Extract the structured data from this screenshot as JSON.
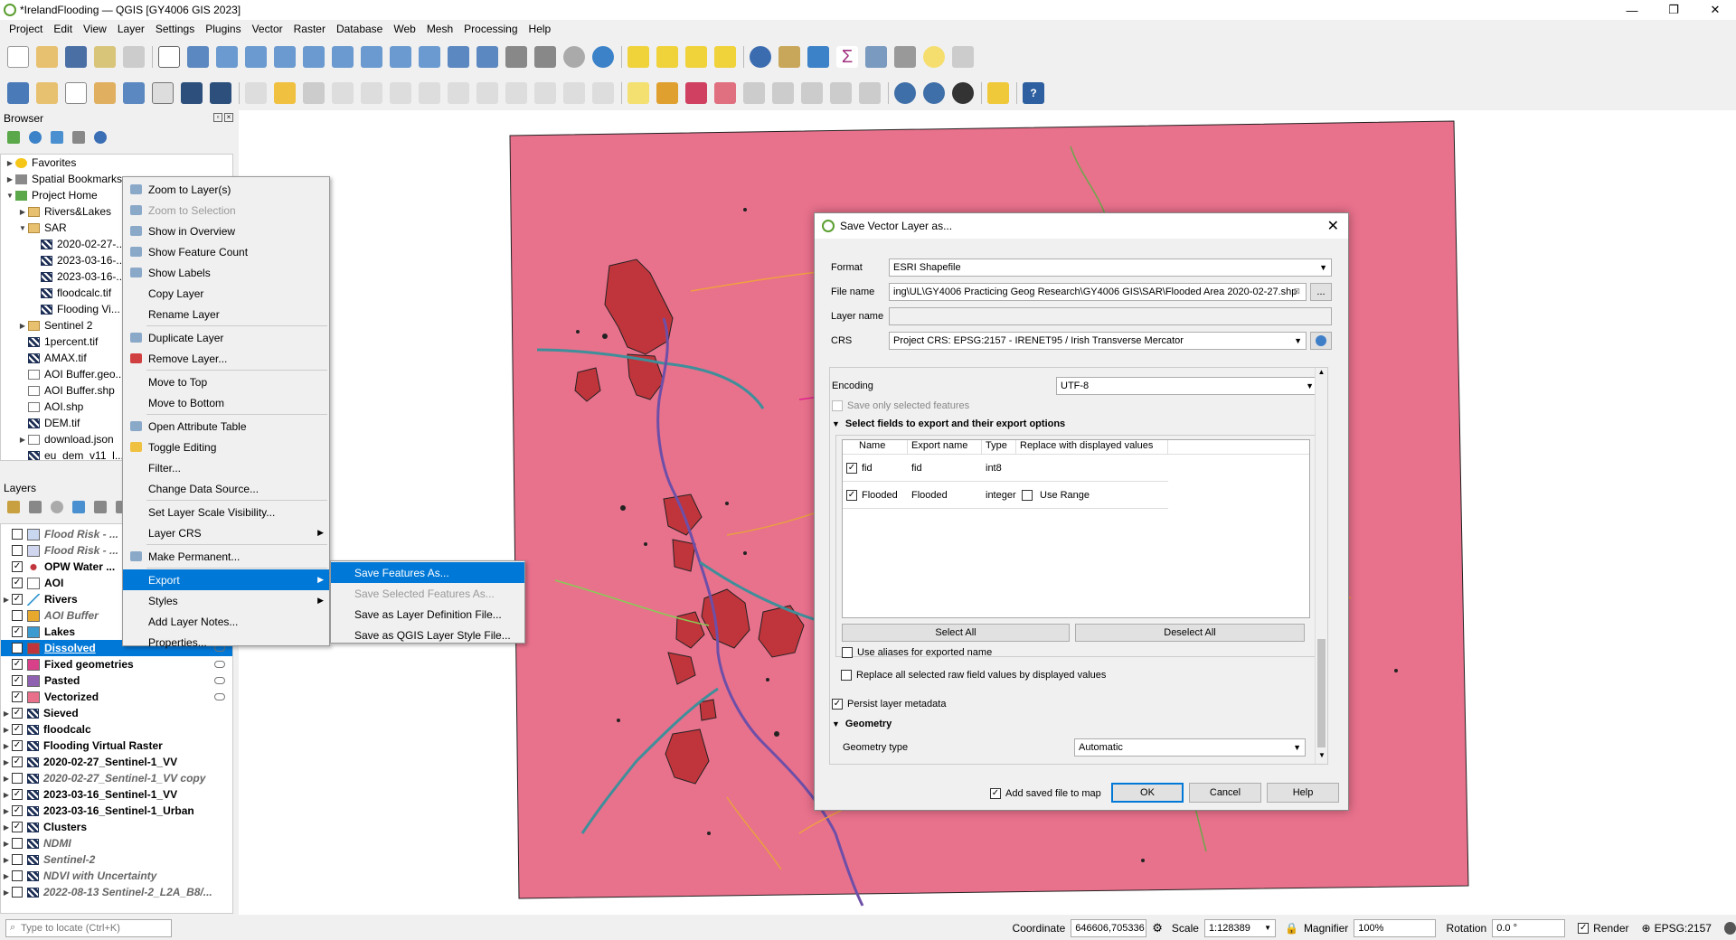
{
  "window": {
    "title": "*IrelandFlooding — QGIS [GY4006 GIS 2023]",
    "controls": [
      "—",
      "❐",
      "✕"
    ]
  },
  "menu": [
    "Project",
    "Edit",
    "View",
    "Layer",
    "Settings",
    "Plugins",
    "Vector",
    "Raster",
    "Database",
    "Web",
    "Mesh",
    "Processing",
    "Help"
  ],
  "browser": {
    "title": "Browser",
    "items": [
      {
        "label": "Favorites",
        "indent": 0,
        "arrow": "▶",
        "icon": "star"
      },
      {
        "label": "Spatial Bookmarks",
        "indent": 0,
        "arrow": "▶",
        "icon": "bookmark"
      },
      {
        "label": "Project Home",
        "indent": 0,
        "arrow": "▼",
        "icon": "home"
      },
      {
        "label": "Rivers&Lakes",
        "indent": 1,
        "arrow": "▶",
        "icon": "folder"
      },
      {
        "label": "SAR",
        "indent": 1,
        "arrow": "▼",
        "icon": "folder"
      },
      {
        "label": "2020-02-27-...",
        "indent": 2,
        "arrow": "",
        "icon": "raster"
      },
      {
        "label": "2023-03-16-...",
        "indent": 2,
        "arrow": "",
        "icon": "raster"
      },
      {
        "label": "2023-03-16-...",
        "indent": 2,
        "arrow": "",
        "icon": "raster"
      },
      {
        "label": "floodcalc.tif",
        "indent": 2,
        "arrow": "",
        "icon": "raster"
      },
      {
        "label": "Flooding Vi...",
        "indent": 2,
        "arrow": "",
        "icon": "raster"
      },
      {
        "label": "Sentinel 2",
        "indent": 1,
        "arrow": "▶",
        "icon": "folder"
      },
      {
        "label": "1percent.tif",
        "indent": 1,
        "arrow": "",
        "icon": "raster"
      },
      {
        "label": "AMAX.tif",
        "indent": 1,
        "arrow": "",
        "icon": "raster"
      },
      {
        "label": "AOI Buffer.geo...",
        "indent": 1,
        "arrow": "",
        "icon": "vector"
      },
      {
        "label": "AOI Buffer.shp",
        "indent": 1,
        "arrow": "",
        "icon": "vector"
      },
      {
        "label": "AOI.shp",
        "indent": 1,
        "arrow": "",
        "icon": "vector"
      },
      {
        "label": "DEM.tif",
        "indent": 1,
        "arrow": "",
        "icon": "raster"
      },
      {
        "label": "download.json",
        "indent": 1,
        "arrow": "▶",
        "icon": "vector"
      },
      {
        "label": "eu_dem_v11_l...",
        "indent": 1,
        "arrow": "",
        "icon": "raster"
      }
    ]
  },
  "layers": {
    "title": "Layers",
    "items": [
      {
        "label": "Flood Risk - ...",
        "checked": false,
        "italic": true,
        "swatch": "#c9d6f0",
        "arrow": ""
      },
      {
        "label": "Flood Risk - ...",
        "checked": false,
        "italic": true,
        "swatch": "#d0d6ee",
        "arrow": ""
      },
      {
        "label": "OPW Water ...",
        "checked": true,
        "italic": false,
        "swatch": "dot",
        "arrow": ""
      },
      {
        "label": "AOI",
        "checked": true,
        "italic": false,
        "swatch": "#ffffff",
        "arrow": ""
      },
      {
        "label": "Rivers",
        "checked": true,
        "italic": false,
        "swatch": "line",
        "arrow": "▶"
      },
      {
        "label": "AOI Buffer",
        "checked": false,
        "italic": true,
        "swatch": "#e6a92e",
        "arrow": ""
      },
      {
        "label": "Lakes",
        "checked": true,
        "italic": false,
        "swatch": "#3b9bd1",
        "arrow": ""
      },
      {
        "label": "Dissolved",
        "checked": true,
        "italic": false,
        "swatch": "#c0353b",
        "arrow": "",
        "selected": true
      },
      {
        "label": "Fixed geometries",
        "checked": true,
        "italic": false,
        "swatch": "#d8408a",
        "arrow": ""
      },
      {
        "label": "Pasted",
        "checked": true,
        "italic": false,
        "swatch": "#8e62b0",
        "arrow": ""
      },
      {
        "label": "Vectorized",
        "checked": true,
        "italic": false,
        "swatch": "#e8708a",
        "arrow": ""
      },
      {
        "label": "Sieved",
        "checked": true,
        "italic": false,
        "swatch": "raster",
        "arrow": "▶"
      },
      {
        "label": "floodcalc",
        "checked": true,
        "italic": false,
        "swatch": "raster",
        "arrow": "▶"
      },
      {
        "label": "Flooding Virtual Raster",
        "checked": true,
        "italic": false,
        "swatch": "raster",
        "arrow": "▶"
      },
      {
        "label": "2020-02-27_Sentinel-1_VV",
        "checked": true,
        "italic": false,
        "swatch": "raster",
        "arrow": "▶"
      },
      {
        "label": "2020-02-27_Sentinel-1_VV copy",
        "checked": false,
        "italic": true,
        "swatch": "raster",
        "arrow": "▶"
      },
      {
        "label": "2023-03-16_Sentinel-1_VV",
        "checked": true,
        "italic": false,
        "swatch": "raster",
        "arrow": "▶"
      },
      {
        "label": "2023-03-16_Sentinel-1_Urban",
        "checked": true,
        "italic": false,
        "swatch": "raster",
        "arrow": "▶"
      },
      {
        "label": "Clusters",
        "checked": true,
        "italic": false,
        "swatch": "raster",
        "arrow": "▶"
      },
      {
        "label": "NDMI",
        "checked": false,
        "italic": true,
        "swatch": "raster",
        "arrow": "▶"
      },
      {
        "label": "Sentinel-2",
        "checked": false,
        "italic": true,
        "swatch": "raster",
        "arrow": "▶"
      },
      {
        "label": "NDVI with Uncertainty",
        "checked": false,
        "italic": true,
        "swatch": "raster",
        "arrow": "▶"
      },
      {
        "label": "2022-08-13 Sentinel-2_L2A_B8/...",
        "checked": false,
        "italic": true,
        "swatch": "raster",
        "arrow": "▶"
      }
    ]
  },
  "context_menu": {
    "items": [
      {
        "label": "Zoom to Layer(s)",
        "disabled": false,
        "sub": false,
        "sep": false
      },
      {
        "label": "Zoom to Selection",
        "disabled": true,
        "sub": false,
        "sep": false
      },
      {
        "label": "Show in Overview",
        "disabled": false,
        "sub": false,
        "sep": false
      },
      {
        "label": "Show Feature Count",
        "disabled": false,
        "sub": false,
        "sep": false
      },
      {
        "label": "Show Labels",
        "disabled": false,
        "sub": false,
        "sep": false
      },
      {
        "label": "Copy Layer",
        "disabled": false,
        "sub": false,
        "sep": false
      },
      {
        "label": "Rename Layer",
        "disabled": false,
        "sub": false,
        "sep": true
      },
      {
        "label": "Duplicate Layer",
        "disabled": false,
        "sub": false,
        "sep": false
      },
      {
        "label": "Remove Layer...",
        "disabled": false,
        "sub": false,
        "sep": true
      },
      {
        "label": "Move to Top",
        "disabled": false,
        "sub": false,
        "sep": false
      },
      {
        "label": "Move to Bottom",
        "disabled": false,
        "sub": false,
        "sep": true
      },
      {
        "label": "Open Attribute Table",
        "disabled": false,
        "sub": false,
        "sep": false
      },
      {
        "label": "Toggle Editing",
        "disabled": false,
        "sub": false,
        "sep": false
      },
      {
        "label": "Filter...",
        "disabled": false,
        "sub": false,
        "sep": false
      },
      {
        "label": "Change Data Source...",
        "disabled": false,
        "sub": false,
        "sep": true
      },
      {
        "label": "Set Layer Scale Visibility...",
        "disabled": false,
        "sub": false,
        "sep": false
      },
      {
        "label": "Layer CRS",
        "disabled": false,
        "sub": true,
        "sep": true
      },
      {
        "label": "Make Permanent...",
        "disabled": false,
        "sub": false,
        "sep": true
      },
      {
        "label": "Export",
        "disabled": false,
        "sub": true,
        "sep": false,
        "highlight": true
      },
      {
        "label": "Styles",
        "disabled": false,
        "sub": true,
        "sep": false
      },
      {
        "label": "Add Layer Notes...",
        "disabled": false,
        "sub": false,
        "sep": false
      },
      {
        "label": "Properties...",
        "disabled": false,
        "sub": false,
        "sep": false
      }
    ],
    "export_submenu": [
      {
        "label": "Save Features As...",
        "disabled": false,
        "highlight": true
      },
      {
        "label": "Save Selected Features As...",
        "disabled": true,
        "highlight": false
      },
      {
        "label": "Save as Layer Definition File...",
        "disabled": false,
        "highlight": false
      },
      {
        "label": "Save as QGIS Layer Style File...",
        "disabled": false,
        "highlight": false
      }
    ]
  },
  "dialog": {
    "title": "Save Vector Layer as...",
    "format_label": "Format",
    "format_value": "ESRI Shapefile",
    "filename_label": "File name",
    "filename_value": "ing\\UL\\GY4006 Practicing Geog Research\\GY4006 GIS\\SAR\\Flooded Area 2020-02-27.shp",
    "filename_browse": "...",
    "layername_label": "Layer name",
    "layername_value": "",
    "crs_label": "CRS",
    "crs_value": "Project CRS: EPSG:2157 - IRENET95 / Irish Transverse Mercator",
    "encoding_label": "Encoding",
    "encoding_value": "UTF-8",
    "save_selected": "Save only selected features",
    "fields_section": "Select fields to export and their export options",
    "table_headers": [
      "Name",
      "Export name",
      "Type",
      "Replace with displayed values"
    ],
    "table_rows": [
      {
        "name": "fid",
        "export": "fid",
        "type": "int8",
        "replace": ""
      },
      {
        "name": "Flooded",
        "export": "Flooded",
        "type": "integer",
        "replace": "Use Range"
      }
    ],
    "select_all": "Select All",
    "deselect_all": "Deselect All",
    "use_aliases": "Use aliases for exported name",
    "replace_raw": "Replace all selected raw field values by displayed values",
    "persist_meta": "Persist layer metadata",
    "geometry_section": "Geometry",
    "geometry_type_label": "Geometry type",
    "geometry_type_value": "Automatic",
    "add_saved": "Add saved file to map",
    "ok": "OK",
    "cancel": "Cancel",
    "help": "Help"
  },
  "statusbar": {
    "locate_placeholder": "Type to locate (Ctrl+K)",
    "coordinate_label": "Coordinate",
    "coordinate_value": "646606,705336",
    "scale_label": "Scale",
    "scale_value": "1:128389",
    "magnifier_label": "Magnifier",
    "magnifier_value": "100%",
    "rotation_label": "Rotation",
    "rotation_value": "0.0 °",
    "render_label": "Render",
    "crs": "EPSG:2157"
  },
  "colors": {
    "map_fill": "#e8718c",
    "flood": "#c0353b",
    "river": "#3e8f9a",
    "river2": "#6d4fa8"
  }
}
